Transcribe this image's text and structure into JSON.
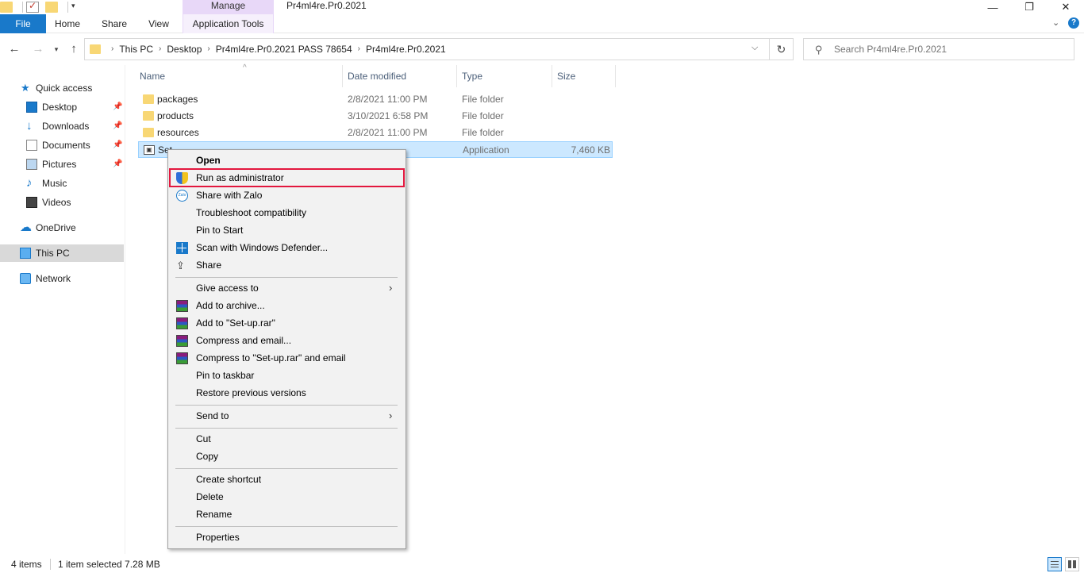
{
  "titlebar": {
    "manage_label": "Manage",
    "window_title": "Pr4ml4re.Pr0.2021",
    "minimize": "—",
    "maximize": "❐",
    "close": "✕"
  },
  "ribbon": {
    "tabs": [
      {
        "label": "File"
      },
      {
        "label": "Home"
      },
      {
        "label": "Share"
      },
      {
        "label": "View"
      },
      {
        "label": "Application Tools"
      }
    ],
    "expand_icon": "chevron-down-icon",
    "help": "?"
  },
  "address": {
    "crumbs": [
      "This PC",
      "Desktop",
      "Pr4ml4re.Pr0.2021 PASS 78654",
      "Pr4ml4re.Pr0.2021"
    ],
    "search_placeholder": "Search Pr4ml4re.Pr0.2021"
  },
  "navpane": {
    "quick_access": "Quick access",
    "desktop": "Desktop",
    "downloads": "Downloads",
    "documents": "Documents",
    "pictures": "Pictures",
    "music": "Music",
    "videos": "Videos",
    "onedrive": "OneDrive",
    "this_pc": "This PC",
    "network": "Network"
  },
  "filelist": {
    "columns": {
      "name": "Name",
      "date": "Date modified",
      "type": "Type",
      "size": "Size"
    },
    "rows": [
      {
        "name": "packages",
        "date": "2/8/2021 11:00 PM",
        "type": "File folder",
        "size": ""
      },
      {
        "name": "products",
        "date": "3/10/2021 6:58 PM",
        "type": "File folder",
        "size": ""
      },
      {
        "name": "resources",
        "date": "2/8/2021 11:00 PM",
        "type": "File folder",
        "size": ""
      },
      {
        "name": "Set",
        "date": "",
        "type": "Application",
        "size": "7,460 KB"
      }
    ]
  },
  "context_menu": {
    "items": {
      "open": "Open",
      "run_admin": "Run as administrator",
      "share_zalo": "Share with Zalo",
      "troubleshoot": "Troubleshoot compatibility",
      "pin_start": "Pin to Start",
      "scan_defender": "Scan with Windows Defender...",
      "share": "Share",
      "give_access": "Give access to",
      "add_archive": "Add to archive...",
      "add_rar": "Add to \"Set-up.rar\"",
      "compress_email": "Compress and email...",
      "compress_rar_email": "Compress to \"Set-up.rar\" and email",
      "pin_taskbar": "Pin to taskbar",
      "restore_versions": "Restore previous versions",
      "send_to": "Send to",
      "cut": "Cut",
      "copy": "Copy",
      "create_shortcut": "Create shortcut",
      "delete": "Delete",
      "rename": "Rename",
      "properties": "Properties"
    },
    "zalo_icon_text": "Zalo",
    "highlight_color": "#e3173e"
  },
  "statusbar": {
    "items": "4 items",
    "selected": "1 item selected  7.28 MB"
  },
  "colors": {
    "accent": "#1979ca",
    "selection": "#cce8ff",
    "manage_tab": "#e8d8f8"
  }
}
